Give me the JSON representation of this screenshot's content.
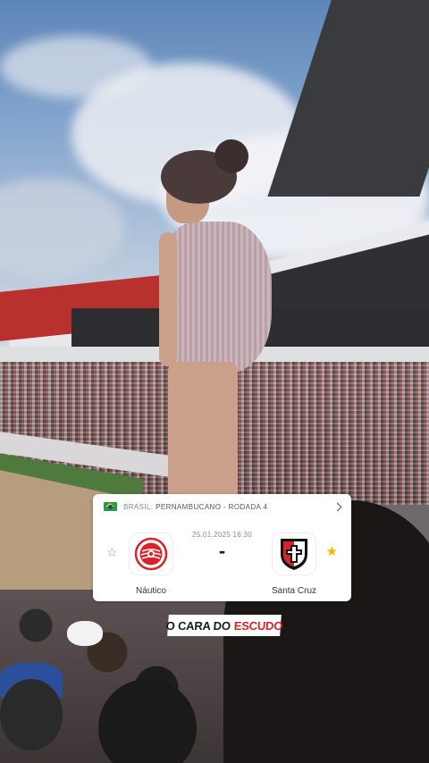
{
  "match_card": {
    "country": "BRASIL:",
    "competition": "PERNAMBUCANO - RODADA 4",
    "datetime": "25.01.2025 16:30",
    "score": "-",
    "home_team": {
      "name": "Náutico",
      "favorite": false,
      "crest_colors": [
        "#d8232a",
        "#ffffff"
      ]
    },
    "away_team": {
      "name": "Santa Cruz",
      "favorite": true,
      "crest_colors": [
        "#111111",
        "#d8232a",
        "#ffffff"
      ]
    },
    "icons": {
      "flag": "brazil-flag-icon",
      "chevron": "chevron-right-icon",
      "star_empty": "star-outline-icon",
      "star_filled": "star-filled-icon"
    },
    "colors": {
      "favorite_star": "#f2b500"
    }
  },
  "caption": {
    "part1": "O CARA DO",
    "part2": "ESCUDO",
    "colors": {
      "part1": "#1a1a1a",
      "part2": "#d8232a",
      "background": "#ffffff"
    }
  }
}
